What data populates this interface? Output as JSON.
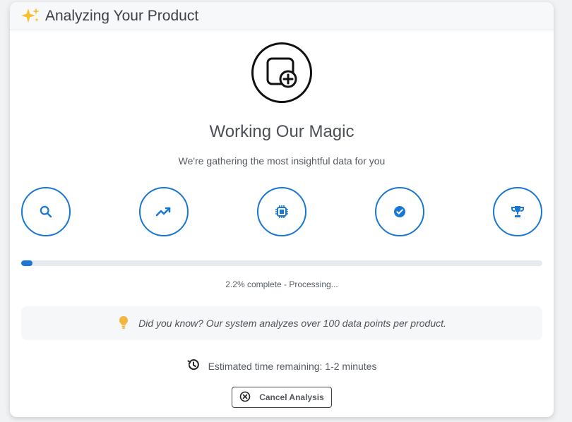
{
  "dialog": {
    "title": "Analyzing Your Product",
    "hero_title": "Working Our Magic",
    "subtitle": "We're gathering the most insightful data for you"
  },
  "steps": [
    {
      "icon": "search-icon",
      "color": "#1976d2"
    },
    {
      "icon": "trend-icon",
      "color": "#1976d2"
    },
    {
      "icon": "chip-icon",
      "color": "#1976d2"
    },
    {
      "icon": "check-circle-icon",
      "color": "#1976d2"
    },
    {
      "icon": "trophy-icon",
      "color": "#1976d2"
    }
  ],
  "progress": {
    "percent": 2.2,
    "text": "2.2% complete - Processing..."
  },
  "tip": {
    "icon": "lightbulb-icon",
    "text": "Did you know? Our system analyzes over 100 data points per product."
  },
  "eta": {
    "icon": "history-icon",
    "text": "Estimated time remaining: 1-2 minutes"
  },
  "actions": {
    "cancel_label": "Cancel Analysis",
    "cancel_icon": "cancel-circle-icon"
  },
  "colors": {
    "accent": "#1976d2",
    "hero_stroke": "#111111",
    "tip_bulb": "#f4b63f"
  }
}
